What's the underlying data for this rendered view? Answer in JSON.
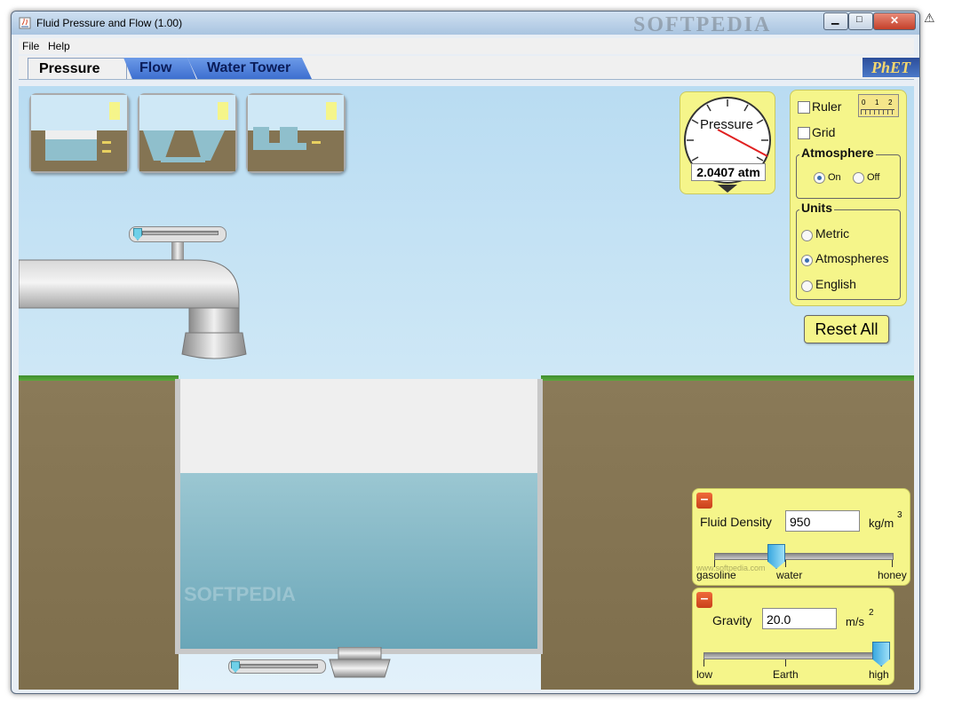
{
  "window": {
    "title": "Fluid Pressure and Flow (1.00)",
    "watermark": "SOFTPEDIA",
    "warning_glyph": "⚠"
  },
  "window_controls": {
    "minimize": "▁",
    "maximize": "□",
    "close": "✕"
  },
  "menu": {
    "file": "File",
    "help": "Help"
  },
  "tabs": [
    {
      "label": "Pressure",
      "active": true
    },
    {
      "label": "Flow",
      "active": false
    },
    {
      "label": "Water Tower",
      "active": false
    }
  ],
  "logo": {
    "text": "PhET"
  },
  "gauge": {
    "label": "Pressure",
    "value": "2.0407 atm"
  },
  "options": {
    "ruler": {
      "label": "Ruler",
      "checked": false,
      "ticks": [
        "0",
        "1",
        "2"
      ]
    },
    "grid": {
      "label": "Grid",
      "checked": false
    },
    "atmosphere": {
      "title": "Atmosphere",
      "on": "On",
      "off": "Off",
      "selected": "On"
    },
    "units": {
      "title": "Units",
      "metric": "Metric",
      "atmospheres": "Atmospheres",
      "english": "English",
      "selected": "Atmospheres"
    }
  },
  "reset_button": "Reset All",
  "fluid_density": {
    "label": "Fluid Density",
    "value": "950",
    "unit": "kg/m",
    "unit_sup": "3",
    "ticks": [
      "gasoline",
      "water",
      "honey"
    ]
  },
  "gravity": {
    "label": "Gravity",
    "value": "20.0",
    "unit": "m/s",
    "unit_sup": "2",
    "ticks": [
      "low",
      "Earth",
      "high"
    ]
  },
  "colors": {
    "sky": "#cfe8f6",
    "water": "#8fbfcc",
    "ground": "#847453",
    "panel": "#f5f58a",
    "tab_active": "#f0f0f0",
    "tab_inactive": "#4a7fdc"
  },
  "overlay_watermark": "SOFTPEDIA",
  "overlay_url": "www.softpedia.com"
}
